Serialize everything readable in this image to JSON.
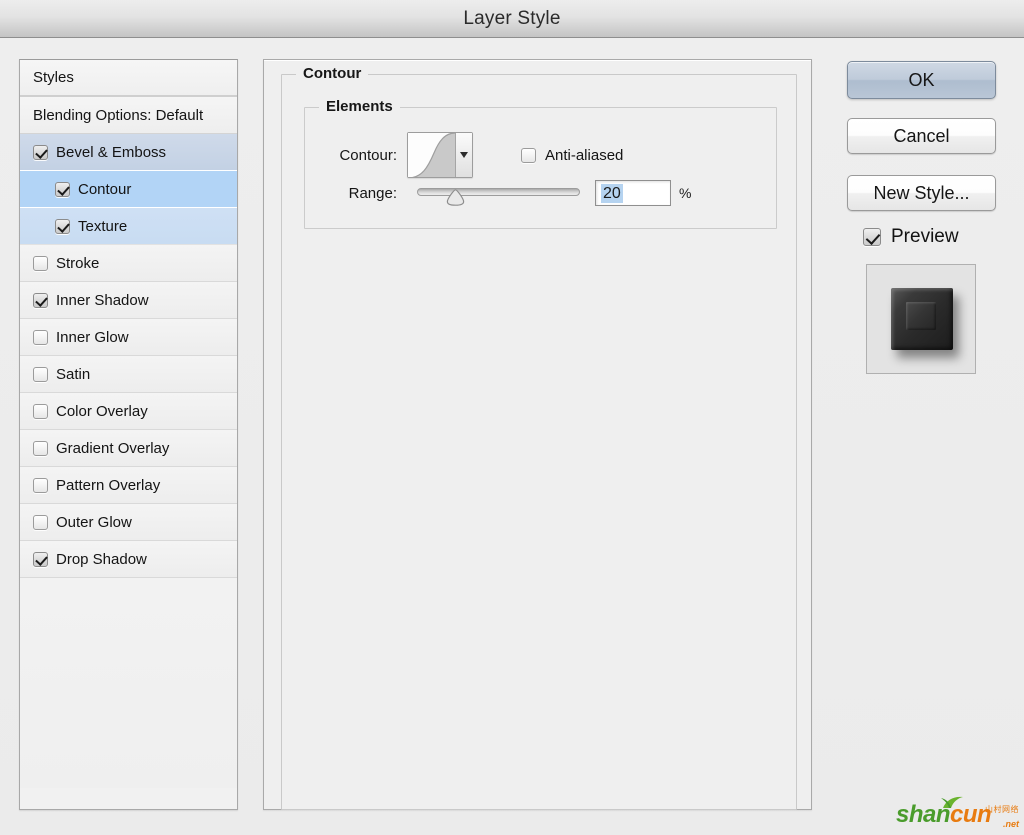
{
  "window": {
    "title": "Layer Style"
  },
  "styles_list": {
    "header": "Styles",
    "blending_options": "Blending Options: Default",
    "items": [
      {
        "label": "Bevel & Emboss",
        "checked": true,
        "indent": false,
        "state": "sel-parent"
      },
      {
        "label": "Contour",
        "checked": true,
        "indent": true,
        "state": "sel-active"
      },
      {
        "label": "Texture",
        "checked": true,
        "indent": true,
        "state": "sel-child"
      },
      {
        "label": "Stroke",
        "checked": false,
        "indent": false,
        "state": "normal"
      },
      {
        "label": "Inner Shadow",
        "checked": true,
        "indent": false,
        "state": "normal"
      },
      {
        "label": "Inner Glow",
        "checked": false,
        "indent": false,
        "state": "normal"
      },
      {
        "label": "Satin",
        "checked": false,
        "indent": false,
        "state": "normal"
      },
      {
        "label": "Color Overlay",
        "checked": false,
        "indent": false,
        "state": "normal"
      },
      {
        "label": "Gradient Overlay",
        "checked": false,
        "indent": false,
        "state": "normal"
      },
      {
        "label": "Pattern Overlay",
        "checked": false,
        "indent": false,
        "state": "normal"
      },
      {
        "label": "Outer Glow",
        "checked": false,
        "indent": false,
        "state": "normal"
      },
      {
        "label": "Drop Shadow",
        "checked": true,
        "indent": false,
        "state": "normal"
      }
    ]
  },
  "panel": {
    "group_title": "Contour",
    "elements_title": "Elements",
    "contour_label": "Contour:",
    "anti_aliased_label": "Anti-aliased",
    "anti_aliased_checked": false,
    "range_label": "Range:",
    "range_value": "20",
    "range_percent_symbol": "%",
    "range_slider_position_percent": 20
  },
  "buttons": {
    "ok": "OK",
    "cancel": "Cancel",
    "new_style": "New Style...",
    "preview_label": "Preview",
    "preview_checked": true
  },
  "watermark": {
    "brand_part1": "shan",
    "brand_part2": "cun",
    "domain": ".net",
    "cn_text": "山村网络"
  },
  "colors": {
    "selection_active": "#b2d4f6",
    "selection_parent": "#c3d1e4",
    "default_button": "#bfcbda",
    "text_selection": "#b5d3f0",
    "brand_green": "#4a9c2c",
    "brand_orange": "#e87b10"
  }
}
